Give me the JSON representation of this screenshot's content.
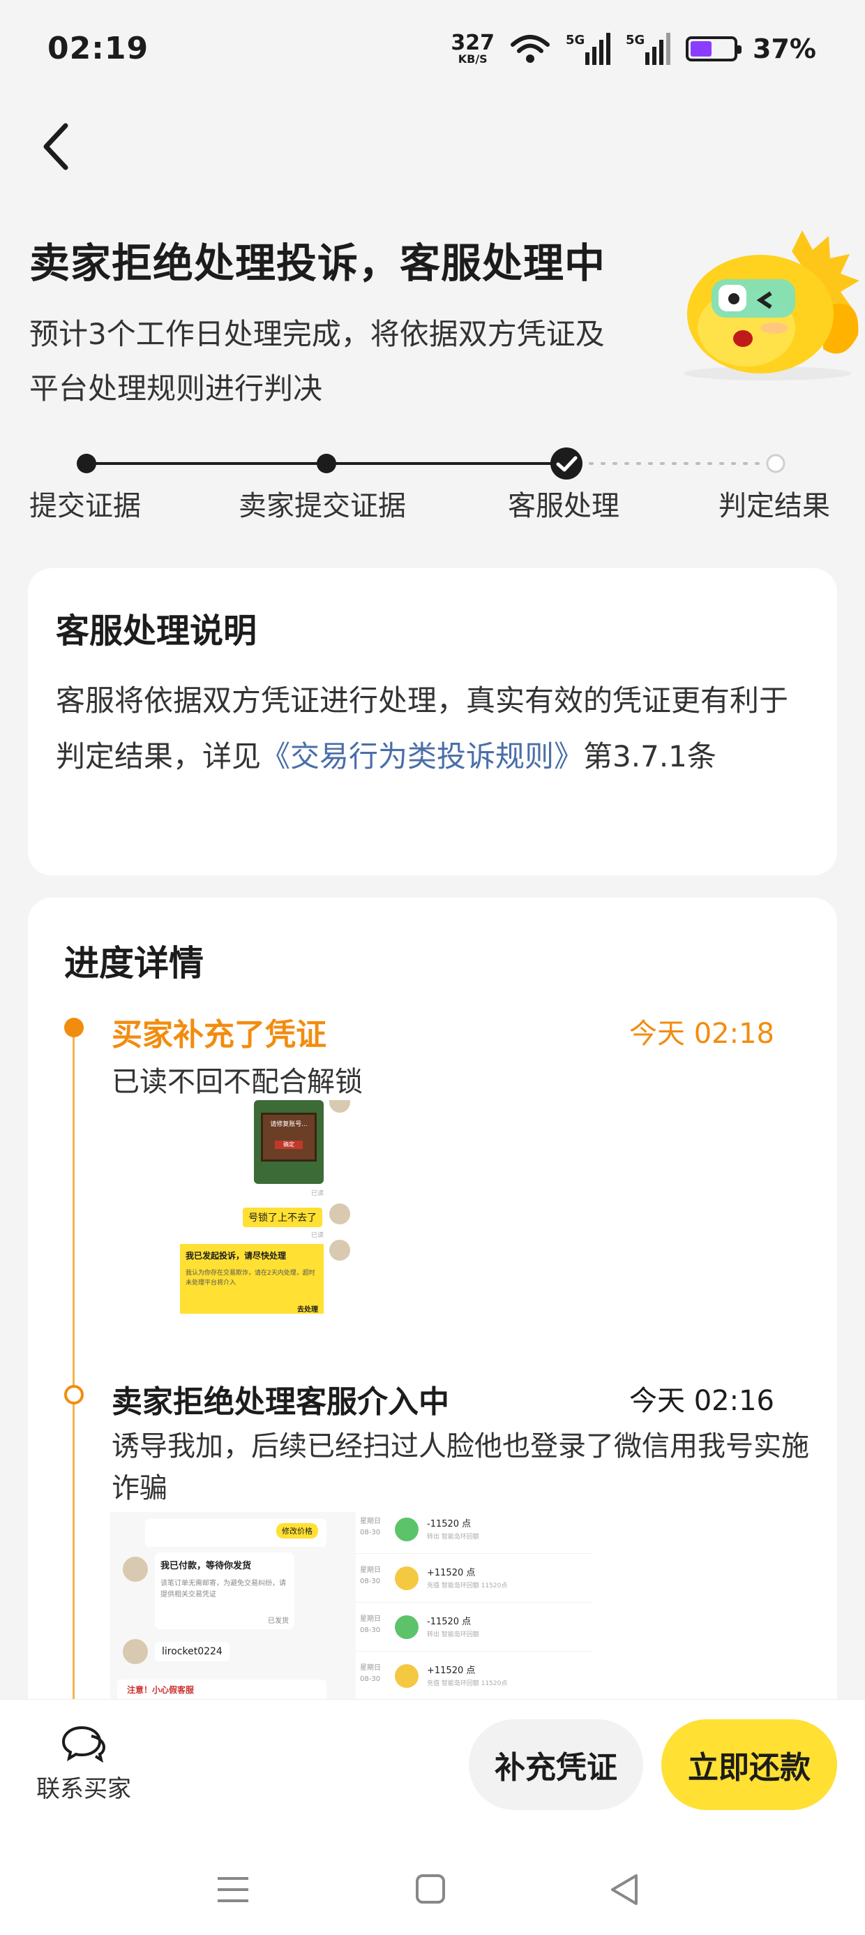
{
  "status_bar": {
    "time": "02:19",
    "speed_value": "327",
    "speed_unit": "KB/S",
    "net1": "5G",
    "net2": "5G",
    "battery": "37%"
  },
  "header": {
    "title": "卖家拒绝处理投诉，客服处理中",
    "subtitle_line1": "预计3个工作日处理完成，将依据双方凭证及",
    "subtitle_line2": "平台处理规则进行判决"
  },
  "steps": [
    {
      "label": "提交证据",
      "state": "done"
    },
    {
      "label": "卖家提交证据",
      "state": "done"
    },
    {
      "label": "客服处理",
      "state": "current"
    },
    {
      "label": "判定结果",
      "state": "pending"
    }
  ],
  "explain": {
    "heading": "客服处理说明",
    "text_before": "客服将依据双方凭证进行处理，真实有效的凭证更有利于判定结果，详见",
    "link": "《交易行为类投诉规则》",
    "text_after": "第3.7.1条"
  },
  "progress": {
    "heading": "进度详情",
    "events": [
      {
        "title": "买家补充了凭证",
        "time": "今天 02:18",
        "desc": "已读不回不配合解锁",
        "shot": {
          "popup_title": "请修复账号...",
          "popup_btn": "确定",
          "msg1": "号锁了上不去了",
          "bubble_title": "我已发起投诉，请尽快处理",
          "bubble_body": "我认为你存在交易欺诈，请在2天内处理，超时未处理平台将介入",
          "bubble_foot": "去处理",
          "read1": "已读",
          "read2": "已读"
        }
      },
      {
        "title": "卖家拒绝处理客服介入中",
        "time": "今天 02:16",
        "desc": "诱导我加，后续已经扫过人脸他也登录了微信用我号实施诈骗",
        "shot_left": {
          "tag": "修改价格",
          "card_title": "我已付款，等待你发货",
          "card_body": "该笔订单无需邮寄，为避免交易纠纷，请提供相关交易凭证",
          "card_btn": "已发货",
          "user": "lirocket0224",
          "warn": "注意！小心假客服"
        },
        "shot_right": [
          {
            "day": "星期日",
            "date": "08-30",
            "amount": "-11520 点",
            "note": "转出 智能岛环回额",
            "kind": "out"
          },
          {
            "day": "星期日",
            "date": "08-30",
            "amount": "+11520 点",
            "note": "充值 智能岛环回额 11520点",
            "kind": "in"
          },
          {
            "day": "星期日",
            "date": "08-30",
            "amount": "-11520 点",
            "note": "转出 智能岛环回额",
            "kind": "out"
          },
          {
            "day": "星期日",
            "date": "08-30",
            "amount": "+11520 点",
            "note": "充值 智能岛环回额 11520点",
            "kind": "in"
          }
        ]
      }
    ]
  },
  "bottom": {
    "contact_label": "联系买家",
    "btn_add": "补充凭证",
    "btn_pay": "立即还款"
  },
  "colors": {
    "accent": "#ffe033",
    "orange": "#f28c0f",
    "link": "#4a6ea8"
  }
}
